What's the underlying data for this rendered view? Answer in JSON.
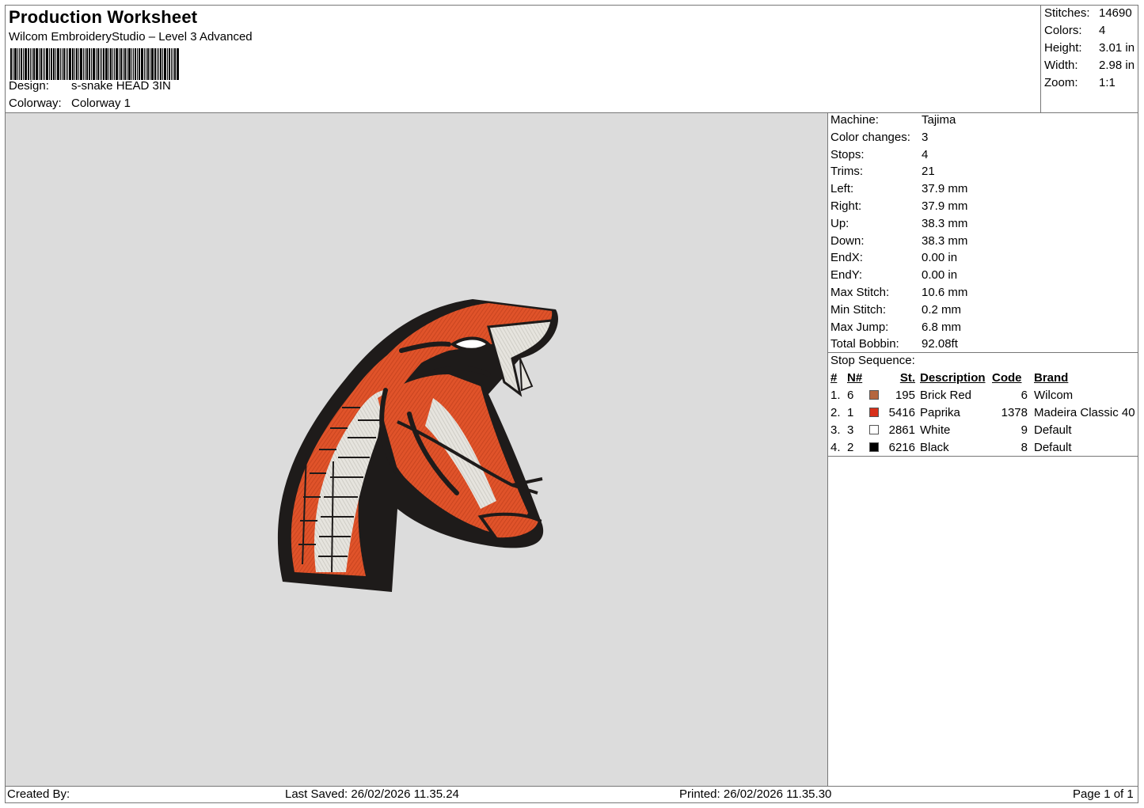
{
  "header": {
    "title": "Production Worksheet",
    "subtitle": "Wilcom EmbroideryStudio – Level 3 Advanced",
    "design_label": "Design:",
    "design_value": "s-snake HEAD 3IN",
    "colorway_label": "Colorway:",
    "colorway_value": "Colorway 1"
  },
  "summary": [
    {
      "label": "Stitches:",
      "value": "14690"
    },
    {
      "label": "Colors:",
      "value": "4"
    },
    {
      "label": "Height:",
      "value": "3.01 in"
    },
    {
      "label": "Width:",
      "value": "2.98 in"
    },
    {
      "label": "Zoom:",
      "value": "1:1"
    }
  ],
  "properties": [
    {
      "label": "Machine:",
      "value": "Tajima"
    },
    {
      "label": "Color changes:",
      "value": "3"
    },
    {
      "label": "Stops:",
      "value": "4"
    },
    {
      "label": "Trims:",
      "value": "21"
    },
    {
      "label": "Left:",
      "value": "37.9 mm"
    },
    {
      "label": "Right:",
      "value": "37.9 mm"
    },
    {
      "label": "Up:",
      "value": "38.3 mm"
    },
    {
      "label": "Down:",
      "value": "38.3 mm"
    },
    {
      "label": "EndX:",
      "value": "0.00 in"
    },
    {
      "label": "EndY:",
      "value": "0.00 in"
    },
    {
      "label": "Max Stitch:",
      "value": "10.6 mm"
    },
    {
      "label": "Min Stitch:",
      "value": "0.2 mm"
    },
    {
      "label": "Max Jump:",
      "value": "6.8 mm"
    },
    {
      "label": "Total Bobbin:",
      "value": "92.08ft"
    }
  ],
  "stop_sequence": {
    "title": "Stop Sequence:",
    "headers": {
      "idx": "#",
      "n": "N#",
      "st": "St.",
      "desc": "Description",
      "code": "Code",
      "brand": "Brand"
    },
    "rows": [
      {
        "idx": "1.",
        "n": "6",
        "color": "#b5663e",
        "st": "195",
        "desc": "Brick Red",
        "code": "6",
        "brand": "Wilcom"
      },
      {
        "idx": "2.",
        "n": "1",
        "color": "#d8301a",
        "st": "5416",
        "desc": "Paprika",
        "code": "1378",
        "brand": "Madeira Classic 40"
      },
      {
        "idx": "3.",
        "n": "3",
        "color": "#ffffff",
        "st": "2861",
        "desc": "White",
        "code": "9",
        "brand": "Default"
      },
      {
        "idx": "4.",
        "n": "2",
        "color": "#000000",
        "st": "6216",
        "desc": "Black",
        "code": "8",
        "brand": "Default"
      }
    ]
  },
  "footer": {
    "created_by": "Created By:",
    "last_saved": "Last Saved: 26/02/2026 11.35.24",
    "printed": "Printed: 26/02/2026 11.35.30",
    "page": "Page 1 of 1"
  },
  "design_preview": {
    "icon": "snake-head-embroidery",
    "canvas_color": "#dcdcdc"
  }
}
